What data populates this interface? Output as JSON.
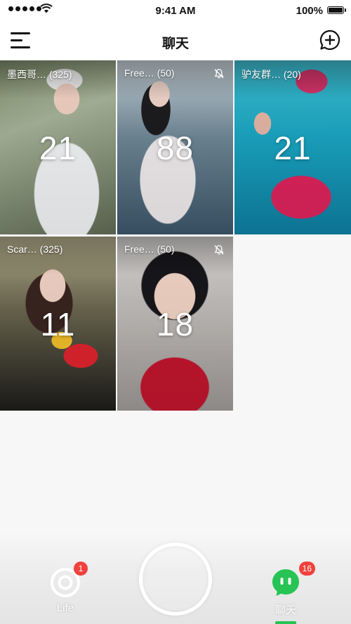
{
  "status_bar": {
    "time": "9:41 AM",
    "battery": "100%"
  },
  "nav": {
    "title": "聊天"
  },
  "chats": [
    {
      "name": "墨西哥… (325)",
      "count": "21",
      "muted": false
    },
    {
      "name": "Free… (50)",
      "count": "88",
      "muted": true
    },
    {
      "name": "驴友群… (20)",
      "count": "21",
      "muted": false
    },
    {
      "name": "Scar… (325)",
      "count": "11",
      "muted": false
    },
    {
      "name": "Free… (50)",
      "count": "18",
      "muted": true
    }
  ],
  "tabs": {
    "life": {
      "label": "Life",
      "badge": "1"
    },
    "chat": {
      "label": "聊天",
      "badge": "16"
    }
  },
  "colors": {
    "accent": "#27c455",
    "badge": "#f0413c"
  }
}
